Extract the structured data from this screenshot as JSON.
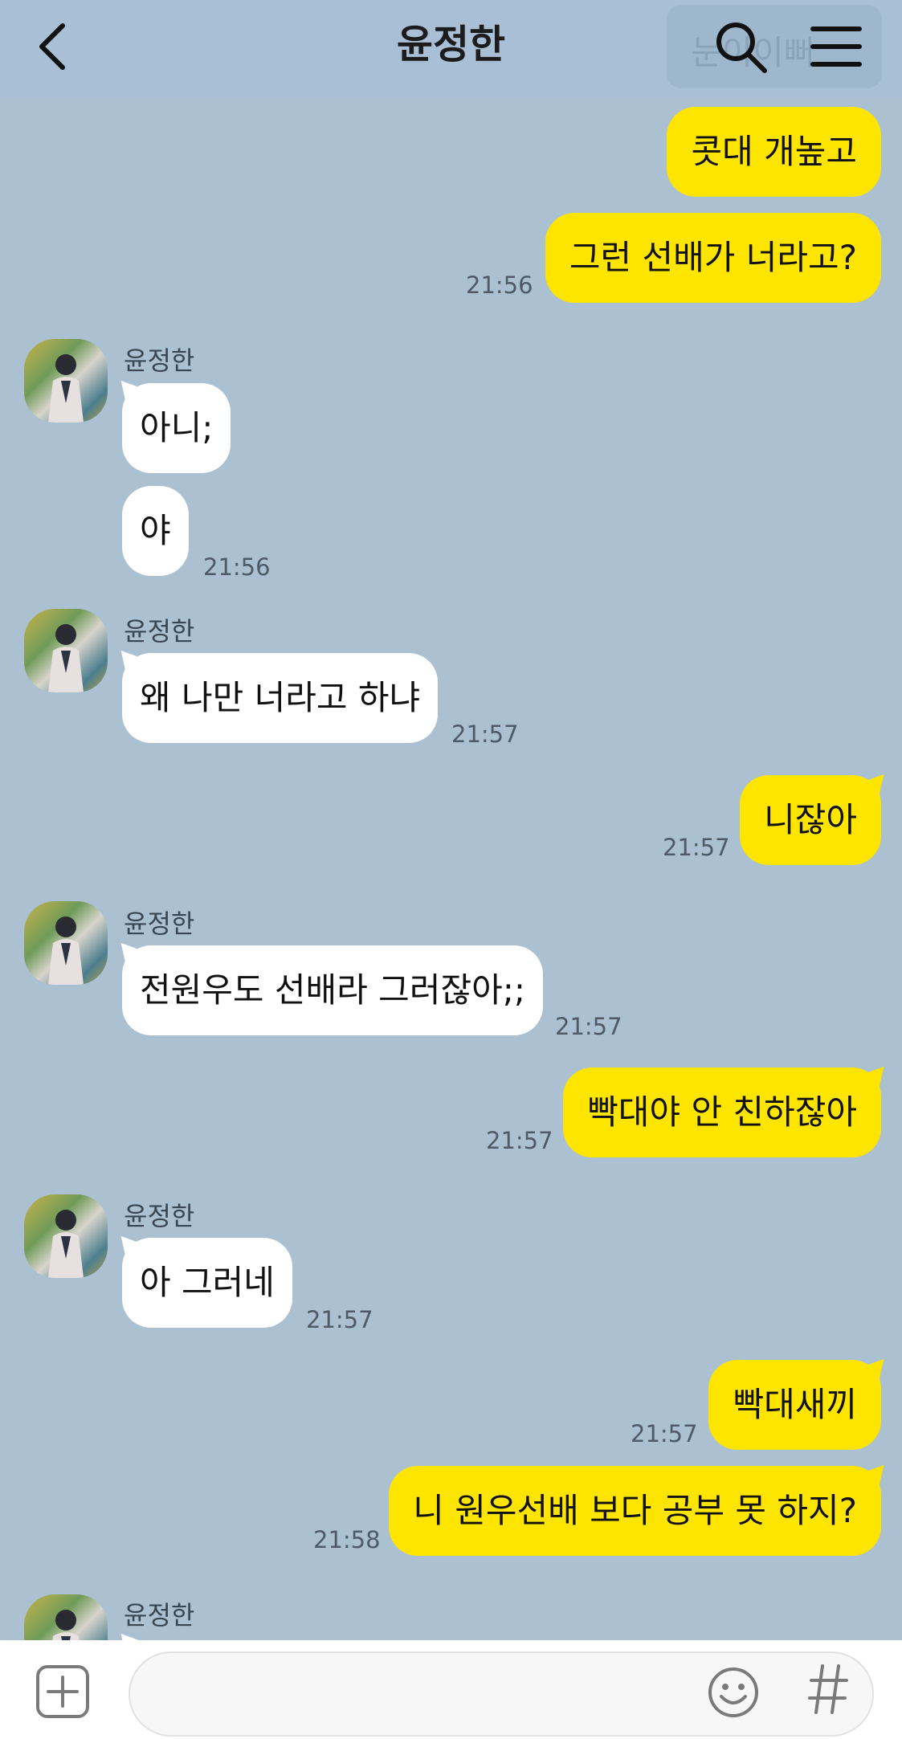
{
  "header": {
    "title": "윤정한",
    "pinned_preview": "눈이이뻐"
  },
  "colors": {
    "background": "#abc1d1",
    "my_bubble": "#fee500",
    "other_bubble": "#ffffff"
  },
  "messages": [
    {
      "sender": "me",
      "text": "콧대 개높고"
    },
    {
      "sender": "me",
      "text": "그런 선배가 너라고?",
      "time": "21:56"
    },
    {
      "sender_name": "윤정한",
      "text": "아니;"
    },
    {
      "sender": "other",
      "text": "야",
      "time": "21:56"
    },
    {
      "sender_name": "윤정한",
      "text": "왜 나만 너라고 하냐",
      "time": "21:57"
    },
    {
      "sender": "me",
      "text": "니잖아",
      "time": "21:57"
    },
    {
      "sender_name": "윤정한",
      "text": "전원우도 선배라 그러잖아;;",
      "time": "21:57"
    },
    {
      "sender": "me",
      "text": "빡대야 안 친하잖아",
      "time": "21:57"
    },
    {
      "sender_name": "윤정한",
      "text": "아 그러네",
      "time": "21:57"
    },
    {
      "sender": "me",
      "text": "빡대새끼",
      "time": "21:57"
    },
    {
      "sender": "me",
      "text": "니 원우선배 보다 공부 못 하지?",
      "time": "21:58"
    },
    {
      "sender_name": "윤정한"
    }
  ],
  "input": {
    "value": "",
    "hash_symbol": "#"
  }
}
